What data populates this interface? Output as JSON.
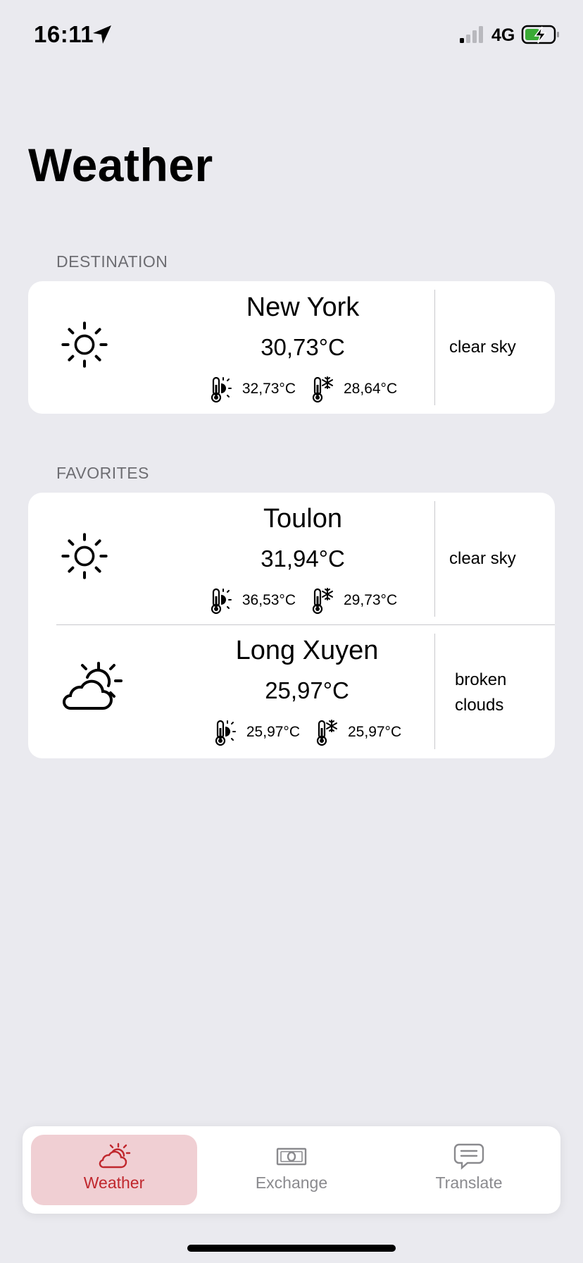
{
  "status_bar": {
    "time": "16:11",
    "network": "4G"
  },
  "page_title": "Weather",
  "destination": {
    "header": "DESTINATION",
    "city": {
      "name": "New York",
      "temp": "30,73°C",
      "temp_max": "32,73°C",
      "temp_min": "28,64°C",
      "description": "clear sky",
      "icon": "sun-icon"
    }
  },
  "favorites": {
    "header": "FAVORITES",
    "cities": [
      {
        "name": "Toulon",
        "temp": "31,94°C",
        "temp_max": "36,53°C",
        "temp_min": "29,73°C",
        "description": "clear sky",
        "icon": "sun-icon"
      },
      {
        "name": "Long Xuyen",
        "temp": "25,97°C",
        "temp_max": "25,97°C",
        "temp_min": "25,97°C",
        "description_line1": "broken",
        "description_line2": "clouds",
        "icon": "cloud-sun-icon"
      }
    ]
  },
  "tab_bar": {
    "tabs": [
      {
        "label": "Weather",
        "active": true
      },
      {
        "label": "Exchange",
        "active": false
      },
      {
        "label": "Translate",
        "active": false
      }
    ]
  },
  "colors": {
    "accent": "#c0272d",
    "active_tab_bg": "#f0cfd3",
    "background": "#eaeaef"
  }
}
